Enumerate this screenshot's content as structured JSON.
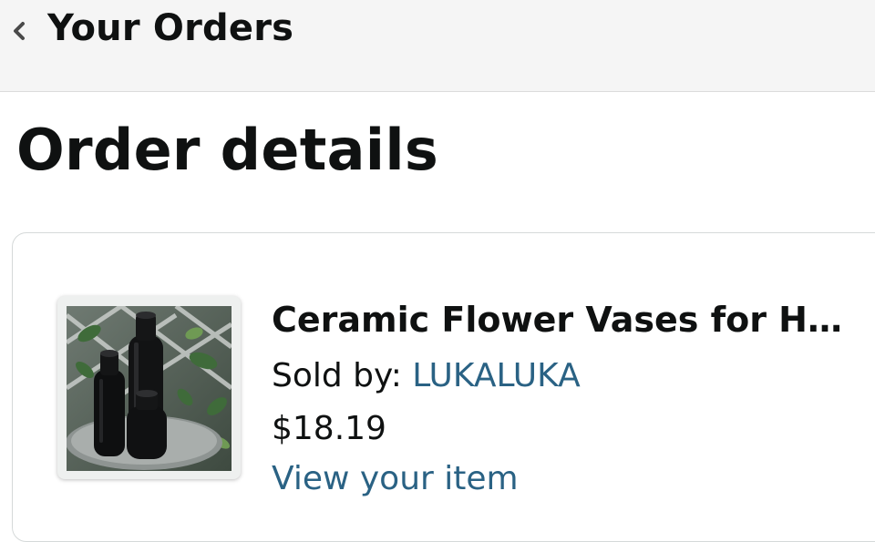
{
  "header": {
    "back_label": "Your Orders",
    "back_icon": "chevron-left-icon"
  },
  "page": {
    "title": "Order details"
  },
  "order_item": {
    "title": "Ceramic Flower Vases for Ho…",
    "sold_by_prefix": "Sold by: ",
    "seller": "LUKALUKA",
    "price": "$18.19",
    "view_link": "View your item",
    "image_icon": "product-image"
  },
  "colors": {
    "link": "#2a6284",
    "text": "#0f1111",
    "header_bg": "#f5f5f5"
  }
}
